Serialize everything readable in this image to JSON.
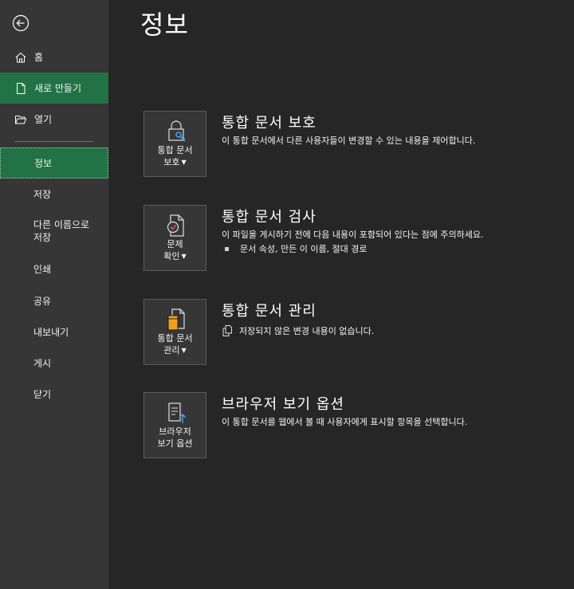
{
  "sidebar": {
    "items": [
      {
        "label": "홈",
        "icon": "home-icon"
      },
      {
        "label": "새로 만들기",
        "icon": "new-document-icon"
      },
      {
        "label": "열기",
        "icon": "open-folder-icon"
      },
      {
        "label": "정보"
      },
      {
        "label": "저장"
      },
      {
        "label": "다른 이름으로",
        "label2": "저장"
      },
      {
        "label": "인쇄"
      },
      {
        "label": "공유"
      },
      {
        "label": "내보내기"
      },
      {
        "label": "게시"
      },
      {
        "label": "닫기"
      }
    ],
    "back_icon": "back-arrow-icon"
  },
  "main": {
    "title": "정보",
    "sections": [
      {
        "button_line1": "통합 문서",
        "button_line2": "보호",
        "title": "통합 문서 보호",
        "description": "이 통합 문서에서 다른 사용자들이 변경할 수 있는 내용을 제어합니다.",
        "icon": "lock-key-icon"
      },
      {
        "button_line1": "문제",
        "button_line2": "확인",
        "title": "통합 문서 검사",
        "description": "이 파일을 게시하기 전에 다음 내용이 포함되어 있다는 점에 주의하세요.",
        "bullet": "문서 속성, 만든 이 이름, 절대 경로",
        "icon": "check-document-icon"
      },
      {
        "button_line1": "통합 문서",
        "button_line2": "관리",
        "title": "통합 문서 관리",
        "status": "저장되지 않은 변경 내용이 없습니다.",
        "icon": "manage-workbook-icon"
      },
      {
        "button_line1": "브라우저",
        "button_line2": "보기 옵션",
        "title": "브라우저 보기 옵션",
        "description": "이 통합 문서를 웹에서 볼 때 사용자에게 표시할 항목을 선택합니다.",
        "icon": "browser-view-icon"
      }
    ]
  },
  "colors": {
    "sidebar_bg": "#363636",
    "main_bg": "#262626",
    "accent_green": "#217346"
  }
}
